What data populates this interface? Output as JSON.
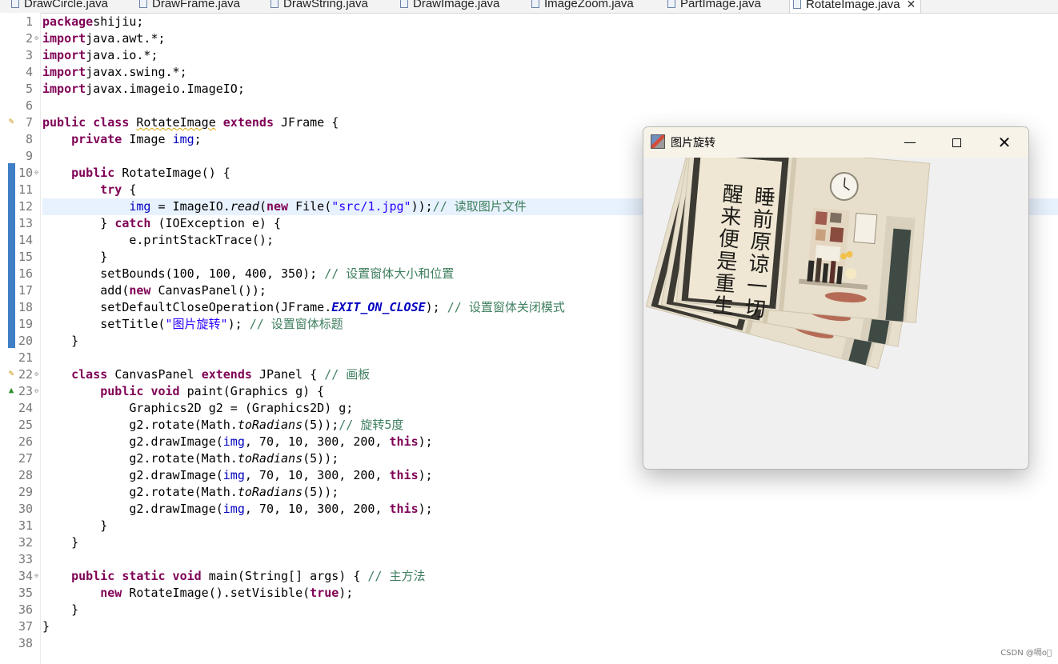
{
  "tabs": [
    {
      "label": "DrawCircle.java"
    },
    {
      "label": "DrawFrame.java"
    },
    {
      "label": "DrawString.java"
    },
    {
      "label": "DrawImage.java"
    },
    {
      "label": "ImageZoom.java"
    },
    {
      "label": "PartImage.java"
    },
    {
      "label": "RotateImage.java",
      "active": true
    }
  ],
  "code": {
    "current_line": 12,
    "lines": [
      {
        "n": 1,
        "t": [
          [
            "kw",
            "package"
          ],
          [
            "",
            "shijiu;"
          ]
        ]
      },
      {
        "n": 2,
        "t": [
          [
            "kw",
            "import"
          ],
          [
            "",
            "java.awt.*;"
          ]
        ]
      },
      {
        "n": 3,
        "t": [
          [
            "kw",
            "import"
          ],
          [
            "",
            "java.io.*;"
          ]
        ]
      },
      {
        "n": 4,
        "t": [
          [
            "kw",
            "import"
          ],
          [
            "",
            "javax.swing.*;"
          ]
        ]
      },
      {
        "n": 5,
        "t": [
          [
            "kw",
            "import"
          ],
          [
            "",
            "javax.imageio.ImageIO;"
          ]
        ]
      },
      {
        "n": 6,
        "t": []
      },
      {
        "n": 7,
        "t": [
          [
            "kw",
            "public class "
          ],
          [
            "squig",
            "RotateImage"
          ],
          [
            "kw",
            " extends "
          ],
          [
            "",
            "JFrame {"
          ]
        ]
      },
      {
        "n": 8,
        "t": [
          [
            "",
            "    "
          ],
          [
            "kw",
            "private "
          ],
          [
            "",
            "Image "
          ],
          [
            "fld",
            "img"
          ],
          [
            "",
            ";"
          ]
        ]
      },
      {
        "n": 9,
        "t": []
      },
      {
        "n": 10,
        "t": [
          [
            "",
            "    "
          ],
          [
            "kw",
            "public "
          ],
          [
            "",
            "RotateImage() {"
          ]
        ]
      },
      {
        "n": 11,
        "t": [
          [
            "",
            "        "
          ],
          [
            "kw",
            "try"
          ],
          [
            "",
            " {"
          ]
        ]
      },
      {
        "n": 12,
        "t": [
          [
            "",
            "            "
          ],
          [
            "fld",
            "img"
          ],
          [
            "",
            " = ImageIO."
          ],
          [
            "it",
            "read"
          ],
          [
            "",
            "("
          ],
          [
            "kw",
            "new "
          ],
          [
            "",
            "File("
          ],
          [
            "str",
            "\"src/1.jpg\""
          ],
          [
            "",
            "));"
          ],
          [
            "cm",
            "// 读取图片文件"
          ]
        ]
      },
      {
        "n": 13,
        "t": [
          [
            "",
            "        } "
          ],
          [
            "kw",
            "catch"
          ],
          [
            "",
            " (IOException e) {"
          ]
        ]
      },
      {
        "n": 14,
        "t": [
          [
            "",
            "            e.printStackTrace();"
          ]
        ]
      },
      {
        "n": 15,
        "t": [
          [
            "",
            "        }"
          ]
        ]
      },
      {
        "n": 16,
        "t": [
          [
            "",
            "        setBounds(100, 100, 400, 350); "
          ],
          [
            "cm",
            "// 设置窗体大小和位置"
          ]
        ]
      },
      {
        "n": 17,
        "t": [
          [
            "",
            "        add("
          ],
          [
            "kw",
            "new "
          ],
          [
            "",
            "CanvasPanel());"
          ]
        ]
      },
      {
        "n": 18,
        "t": [
          [
            "",
            "        setDefaultCloseOperation(JFrame."
          ],
          [
            "sfld",
            "EXIT_ON_CLOSE"
          ],
          [
            "",
            "); "
          ],
          [
            "cm",
            "// 设置窗体关闭模式"
          ]
        ]
      },
      {
        "n": 19,
        "t": [
          [
            "",
            "        setTitle("
          ],
          [
            "str",
            "\"图片旋转\""
          ],
          [
            "",
            "); "
          ],
          [
            "cm",
            "// 设置窗体标题"
          ]
        ]
      },
      {
        "n": 20,
        "t": [
          [
            "",
            "    }"
          ]
        ]
      },
      {
        "n": 21,
        "t": []
      },
      {
        "n": 22,
        "t": [
          [
            "",
            "    "
          ],
          [
            "kw",
            "class "
          ],
          [
            "",
            "CanvasPanel "
          ],
          [
            "kw",
            "extends "
          ],
          [
            "",
            "JPanel { "
          ],
          [
            "cm",
            "// 画板"
          ]
        ]
      },
      {
        "n": 23,
        "t": [
          [
            "",
            "        "
          ],
          [
            "kw",
            "public void "
          ],
          [
            "",
            "paint(Graphics g) {"
          ]
        ]
      },
      {
        "n": 24,
        "t": [
          [
            "",
            "            Graphics2D g2 = (Graphics2D) g;"
          ]
        ]
      },
      {
        "n": 25,
        "t": [
          [
            "",
            "            g2.rotate(Math."
          ],
          [
            "it",
            "toRadians"
          ],
          [
            "",
            "(5));"
          ],
          [
            "cm",
            "// 旋转5度"
          ]
        ]
      },
      {
        "n": 26,
        "t": [
          [
            "",
            "            g2.drawImage("
          ],
          [
            "fld",
            "img"
          ],
          [
            "",
            ", 70, 10, 300, 200, "
          ],
          [
            "kw",
            "this"
          ],
          [
            "",
            ");"
          ]
        ]
      },
      {
        "n": 27,
        "t": [
          [
            "",
            "            g2.rotate(Math."
          ],
          [
            "it",
            "toRadians"
          ],
          [
            "",
            "(5));"
          ]
        ]
      },
      {
        "n": 28,
        "t": [
          [
            "",
            "            g2.drawImage("
          ],
          [
            "fld",
            "img"
          ],
          [
            "",
            ", 70, 10, 300, 200, "
          ],
          [
            "kw",
            "this"
          ],
          [
            "",
            ");"
          ]
        ]
      },
      {
        "n": 29,
        "t": [
          [
            "",
            "            g2.rotate(Math."
          ],
          [
            "it",
            "toRadians"
          ],
          [
            "",
            "(5));"
          ]
        ]
      },
      {
        "n": 30,
        "t": [
          [
            "",
            "            g2.drawImage("
          ],
          [
            "fld",
            "img"
          ],
          [
            "",
            ", 70, 10, 300, 200, "
          ],
          [
            "kw",
            "this"
          ],
          [
            "",
            ");"
          ]
        ]
      },
      {
        "n": 31,
        "t": [
          [
            "",
            "        }"
          ]
        ]
      },
      {
        "n": 32,
        "t": [
          [
            "",
            "    }"
          ]
        ]
      },
      {
        "n": 33,
        "t": []
      },
      {
        "n": 34,
        "t": [
          [
            "",
            "    "
          ],
          [
            "kw",
            "public static void "
          ],
          [
            "",
            "main(String[] args) { "
          ],
          [
            "cm",
            "// 主方法"
          ]
        ]
      },
      {
        "n": 35,
        "t": [
          [
            "",
            "        "
          ],
          [
            "kw",
            "new "
          ],
          [
            "",
            "RotateImage().setVisible("
          ],
          [
            "kw",
            "true"
          ],
          [
            "",
            ");"
          ]
        ]
      },
      {
        "n": 36,
        "t": [
          [
            "",
            "    }"
          ]
        ]
      },
      {
        "n": 37,
        "t": [
          [
            "",
            "}"
          ]
        ]
      },
      {
        "n": 38,
        "t": []
      }
    ]
  },
  "window": {
    "title": "图片旋转",
    "minimize_glyph": "—",
    "close_glyph": "✕",
    "image_text": {
      "right_column": "睡前原谅一切",
      "left_column": "醒来便是重生"
    }
  },
  "watermark": "CSDN @嗝o゚"
}
